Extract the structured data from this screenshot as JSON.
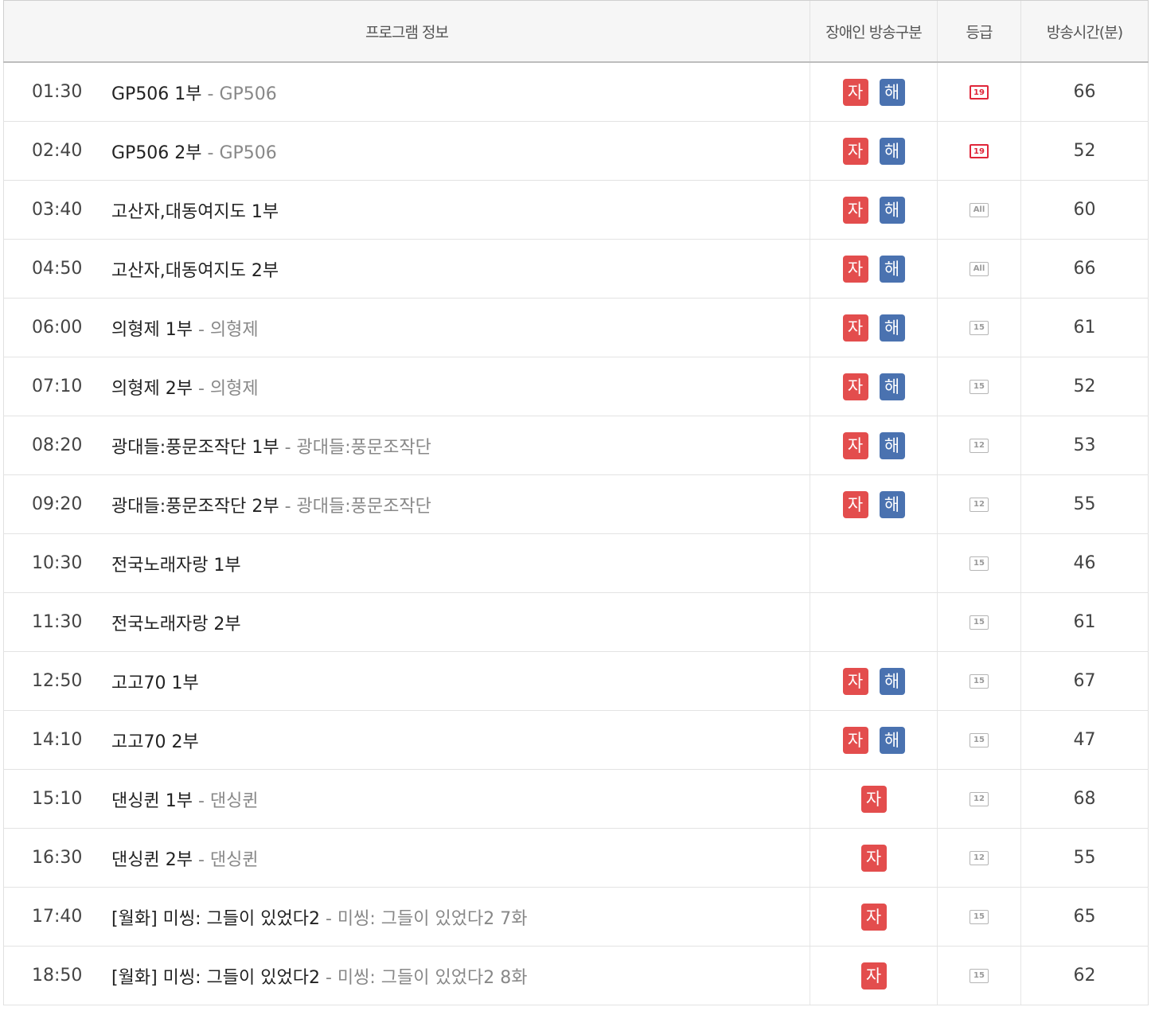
{
  "header": {
    "program_info": "프로그램 정보",
    "disability_type": "장애인 방송구분",
    "grade": "등급",
    "duration": "방송시간(분)"
  },
  "badges": {
    "ja": "자",
    "hae": "해"
  },
  "rows": [
    {
      "time": "01:30",
      "title": "GP506 1부",
      "sub": " - GP506",
      "ja": true,
      "hae": true,
      "grade": "19",
      "grade_class": "g19",
      "minutes": "66"
    },
    {
      "time": "02:40",
      "title": "GP506 2부",
      "sub": " - GP506",
      "ja": true,
      "hae": true,
      "grade": "19",
      "grade_class": "g19",
      "minutes": "52"
    },
    {
      "time": "03:40",
      "title": "고산자,대동여지도 1부",
      "sub": "",
      "ja": true,
      "hae": true,
      "grade": "All",
      "grade_class": "gall",
      "minutes": "60"
    },
    {
      "time": "04:50",
      "title": "고산자,대동여지도 2부",
      "sub": "",
      "ja": true,
      "hae": true,
      "grade": "All",
      "grade_class": "gall",
      "minutes": "66"
    },
    {
      "time": "06:00",
      "title": "의형제 1부",
      "sub": " - 의형제",
      "ja": true,
      "hae": true,
      "grade": "15",
      "grade_class": "g15",
      "minutes": "61"
    },
    {
      "time": "07:10",
      "title": "의형제 2부",
      "sub": " - 의형제",
      "ja": true,
      "hae": true,
      "grade": "15",
      "grade_class": "g15",
      "minutes": "52"
    },
    {
      "time": "08:20",
      "title": "광대들:풍문조작단 1부",
      "sub": " - 광대들:풍문조작단",
      "ja": true,
      "hae": true,
      "grade": "12",
      "grade_class": "g12",
      "minutes": "53"
    },
    {
      "time": "09:20",
      "title": "광대들:풍문조작단 2부",
      "sub": " - 광대들:풍문조작단",
      "ja": true,
      "hae": true,
      "grade": "12",
      "grade_class": "g12",
      "minutes": "55"
    },
    {
      "time": "10:30",
      "title": "전국노래자랑 1부",
      "sub": "",
      "ja": false,
      "hae": false,
      "grade": "15",
      "grade_class": "g15",
      "minutes": "46"
    },
    {
      "time": "11:30",
      "title": "전국노래자랑 2부",
      "sub": "",
      "ja": false,
      "hae": false,
      "grade": "15",
      "grade_class": "g15",
      "minutes": "61"
    },
    {
      "time": "12:50",
      "title": "고고70 1부",
      "sub": "",
      "ja": true,
      "hae": true,
      "grade": "15",
      "grade_class": "g15",
      "minutes": "67"
    },
    {
      "time": "14:10",
      "title": "고고70 2부",
      "sub": "",
      "ja": true,
      "hae": true,
      "grade": "15",
      "grade_class": "g15",
      "minutes": "47"
    },
    {
      "time": "15:10",
      "title": "댄싱퀸 1부",
      "sub": " - 댄싱퀸",
      "ja": true,
      "hae": false,
      "grade": "12",
      "grade_class": "g12",
      "minutes": "68"
    },
    {
      "time": "16:30",
      "title": "댄싱퀸 2부",
      "sub": " - 댄싱퀸",
      "ja": true,
      "hae": false,
      "grade": "12",
      "grade_class": "g12",
      "minutes": "55"
    },
    {
      "time": "17:40",
      "title": "[월화] 미씽: 그들이 있었다2",
      "sub": " - 미씽: 그들이 있었다2 7화",
      "ja": true,
      "hae": false,
      "grade": "15",
      "grade_class": "g15",
      "minutes": "65"
    },
    {
      "time": "18:50",
      "title": "[월화] 미씽: 그들이 있었다2",
      "sub": " - 미씽: 그들이 있었다2 8화",
      "ja": true,
      "hae": false,
      "grade": "15",
      "grade_class": "g15",
      "minutes": "62"
    }
  ]
}
